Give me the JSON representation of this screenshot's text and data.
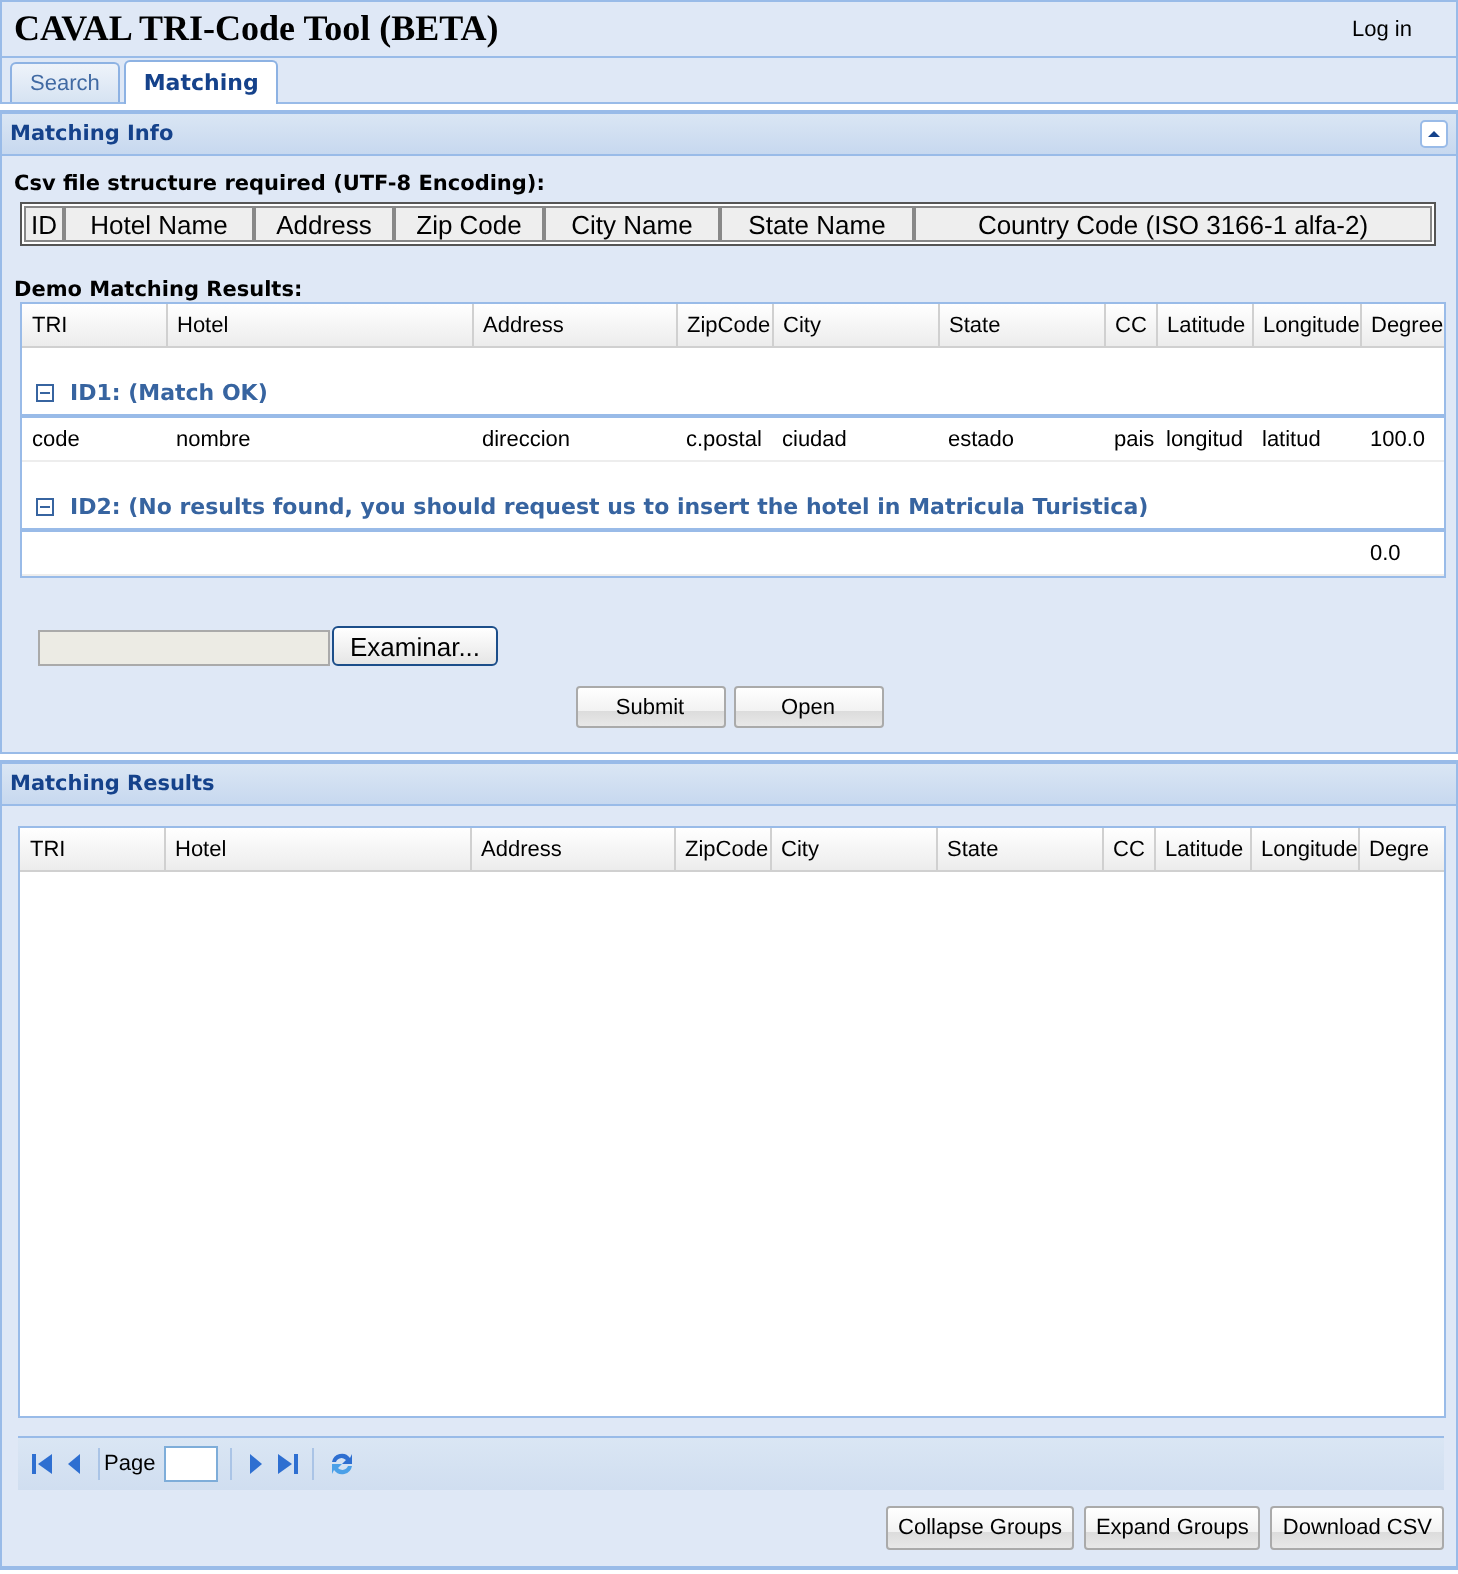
{
  "app": {
    "title": "CAVAL TRI-Code Tool (BETA)",
    "login": "Log in"
  },
  "tabs": [
    {
      "label": "Search",
      "selected": false
    },
    {
      "label": "Matching",
      "selected": true
    }
  ],
  "matching_info": {
    "title": "Matching Info",
    "collapsed": false,
    "csv_label": "Csv file structure required (UTF-8 Encoding):",
    "csv_columns": [
      "ID",
      "Hotel Name",
      "Address",
      "Zip Code",
      "City Name",
      "State Name",
      "Country Code (ISO 3166-1 alfa-2)"
    ],
    "demo_label": "Demo Matching Results:",
    "demo_grid": {
      "columns": [
        "TRI",
        "Hotel",
        "Address",
        "ZipCode",
        "City",
        "State",
        "CC",
        "Latitude",
        "Longitude",
        "Degree"
      ],
      "groups": [
        {
          "title": "ID1: (Match OK)",
          "expanded": true,
          "rows": [
            [
              "code",
              "nombre",
              "direccion",
              "c.postal",
              "ciudad",
              "estado",
              "pais",
              "longitud",
              "latitud",
              "100.0"
            ]
          ]
        },
        {
          "title": "ID2: (No results found, you should request us to insert the hotel in Matricula Turistica)",
          "expanded": true,
          "rows": [
            [
              null,
              null,
              null,
              null,
              null,
              null,
              null,
              null,
              null,
              "0.0"
            ]
          ]
        }
      ]
    },
    "file_button": "Examinar...",
    "buttons": [
      "Submit",
      "Open"
    ]
  },
  "matching_results": {
    "title": "Matching Results",
    "grid": {
      "columns": [
        "TRI",
        "Hotel",
        "Address",
        "ZipCode",
        "City",
        "State",
        "CC",
        "Latitude",
        "Longitude",
        "Degre"
      ]
    },
    "pager": {
      "label": "Page"
    },
    "buttons": [
      "Collapse Groups",
      "Expand Groups",
      "Download CSV"
    ]
  }
}
